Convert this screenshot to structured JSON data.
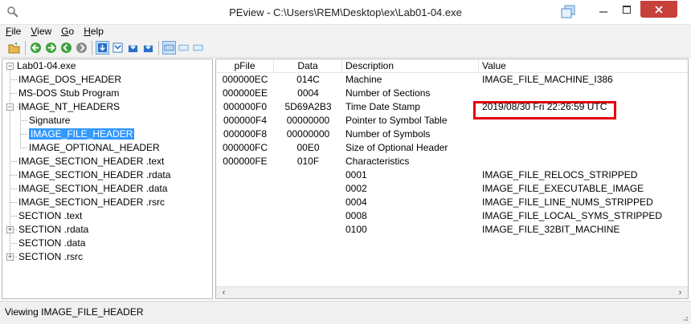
{
  "window": {
    "title": "PEview - C:\\Users\\REM\\Desktop\\ex\\Lab01-04.exe",
    "close_color": "#c7403a"
  },
  "menu": {
    "items": [
      {
        "label": "File"
      },
      {
        "label": "View"
      },
      {
        "label": "Go"
      },
      {
        "label": "Help"
      }
    ]
  },
  "toolbar": {
    "icons": [
      "open-icon",
      "back-icon",
      "forward-icon",
      "up-icon",
      "stop-icon",
      "view-hex-icon",
      "view-dword-icon",
      "view-list-icon",
      "view-tree-icon",
      "layout-icon",
      "layout-2-icon",
      "layout-3-icon"
    ]
  },
  "tree": {
    "items": [
      {
        "label": "Lab01-04.exe"
      },
      {
        "label": "IMAGE_DOS_HEADER"
      },
      {
        "label": "MS-DOS Stub Program"
      },
      {
        "label": "IMAGE_NT_HEADERS"
      },
      {
        "label": "Signature"
      },
      {
        "label": "IMAGE_FILE_HEADER"
      },
      {
        "label": "IMAGE_OPTIONAL_HEADER"
      },
      {
        "label": "IMAGE_SECTION_HEADER .text"
      },
      {
        "label": "IMAGE_SECTION_HEADER .rdata"
      },
      {
        "label": "IMAGE_SECTION_HEADER .data"
      },
      {
        "label": "IMAGE_SECTION_HEADER .rsrc"
      },
      {
        "label": "SECTION .text"
      },
      {
        "label": "SECTION .rdata"
      },
      {
        "label": "SECTION .data"
      },
      {
        "label": "SECTION .rsrc"
      }
    ],
    "selected": "IMAGE_FILE_HEADER"
  },
  "detail": {
    "columns": [
      "pFile",
      "Data",
      "Description",
      "Value"
    ],
    "rows": [
      {
        "pfile": "000000EC",
        "data": "014C",
        "desc": "Machine",
        "value": "IMAGE_FILE_MACHINE_I386"
      },
      {
        "pfile": "000000EE",
        "data": "0004",
        "desc": "Number of Sections",
        "value": ""
      },
      {
        "pfile": "000000F0",
        "data": "5D69A2B3",
        "desc": "Time Date Stamp",
        "value": "2019/08/30 Fri 22:26:59 UTC"
      },
      {
        "pfile": "000000F4",
        "data": "00000000",
        "desc": "Pointer to Symbol Table",
        "value": ""
      },
      {
        "pfile": "000000F8",
        "data": "00000000",
        "desc": "Number of Symbols",
        "value": ""
      },
      {
        "pfile": "000000FC",
        "data": "00E0",
        "desc": "Size of Optional Header",
        "value": ""
      },
      {
        "pfile": "000000FE",
        "data": "010F",
        "desc": "Characteristics",
        "value": ""
      },
      {
        "pfile": "",
        "data": "",
        "desc": "0001",
        "value": "IMAGE_FILE_RELOCS_STRIPPED"
      },
      {
        "pfile": "",
        "data": "",
        "desc": "0002",
        "value": "IMAGE_FILE_EXECUTABLE_IMAGE"
      },
      {
        "pfile": "",
        "data": "",
        "desc": "0004",
        "value": "IMAGE_FILE_LINE_NUMS_STRIPPED"
      },
      {
        "pfile": "",
        "data": "",
        "desc": "0008",
        "value": "IMAGE_FILE_LOCAL_SYMS_STRIPPED"
      },
      {
        "pfile": "",
        "data": "",
        "desc": "0100",
        "value": "IMAGE_FILE_32BIT_MACHINE"
      }
    ],
    "highlight_color": "#e3000b"
  },
  "status": {
    "text": "Viewing IMAGE_FILE_HEADER"
  }
}
